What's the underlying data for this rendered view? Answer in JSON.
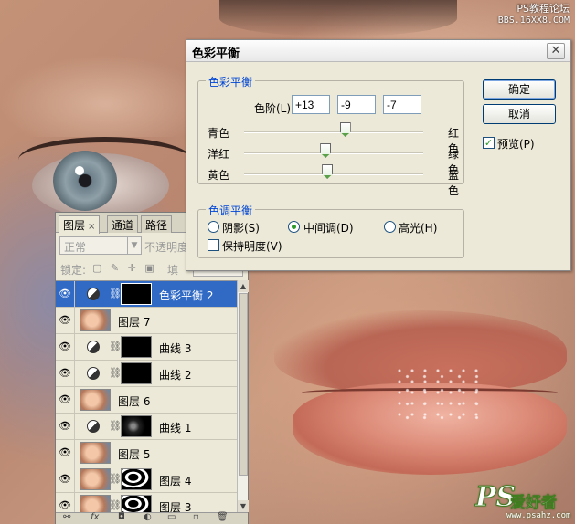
{
  "watermark_top": {
    "line1": "PS教程论坛",
    "line2": "BBS.16XX8.COM"
  },
  "watermark_bottom": {
    "brand": "PS",
    "chinese": "爱好者",
    "url": "www.psahz.com"
  },
  "layers_panel": {
    "tabs": [
      {
        "label": "图层",
        "close": "×",
        "active": true
      },
      {
        "label": "通道",
        "active": false
      },
      {
        "label": "路径",
        "active": false
      }
    ],
    "blend_mode": "正常",
    "opacity_label": "不透明度",
    "lock_label": "锁定:",
    "lock_icons": "▢ ✎ ✛ ▣",
    "fill_label": "填",
    "layers": [
      {
        "name": "色彩平衡 2",
        "type": "adjustment",
        "selected": true
      },
      {
        "name": "图层 7",
        "type": "photo"
      },
      {
        "name": "曲线 3",
        "type": "adjustment"
      },
      {
        "name": "曲线 2",
        "type": "adjustment"
      },
      {
        "name": "图层 6",
        "type": "photo"
      },
      {
        "name": "曲线 1",
        "type": "adjustment"
      },
      {
        "name": "图层 5",
        "type": "photo"
      },
      {
        "name": "图层 4",
        "type": "photo-mask"
      },
      {
        "name": "图层 3",
        "type": "photo-mask"
      }
    ],
    "bottom_icons": [
      "link-icon",
      "fx-icon",
      "mask-icon",
      "adjustment-icon",
      "folder-icon",
      "new-layer-icon",
      "trash-icon"
    ],
    "bottom_glyphs": [
      "⚯",
      "fx",
      "◘",
      "◐",
      "▭",
      "▫",
      "🗑"
    ]
  },
  "dialog": {
    "title": "色彩平衡",
    "close": "✕",
    "color_balance_group": "色彩平衡",
    "levels_label": "色阶(L):",
    "levels": [
      "+13",
      "-9",
      "-7"
    ],
    "sliders": [
      {
        "left": "青色",
        "right": "红色",
        "value": 13
      },
      {
        "left": "洋红",
        "right": "绿色",
        "value": -9
      },
      {
        "left": "黄色",
        "right": "蓝色",
        "value": -7
      }
    ],
    "tone_group": "色调平衡",
    "tones": [
      {
        "label": "阴影(S)",
        "selected": false
      },
      {
        "label": "中间调(D)",
        "selected": true
      },
      {
        "label": "高光(H)",
        "selected": false
      }
    ],
    "preserve_luminosity": "保持明度(V)",
    "preserve_checked": false,
    "buttons": {
      "ok": "确定",
      "cancel": "取消"
    },
    "preview_label": "预览(P)",
    "preview_checked": true,
    "check_mark": "✓",
    "eye_glyph": "👁",
    "chain_glyph": "⛓"
  }
}
